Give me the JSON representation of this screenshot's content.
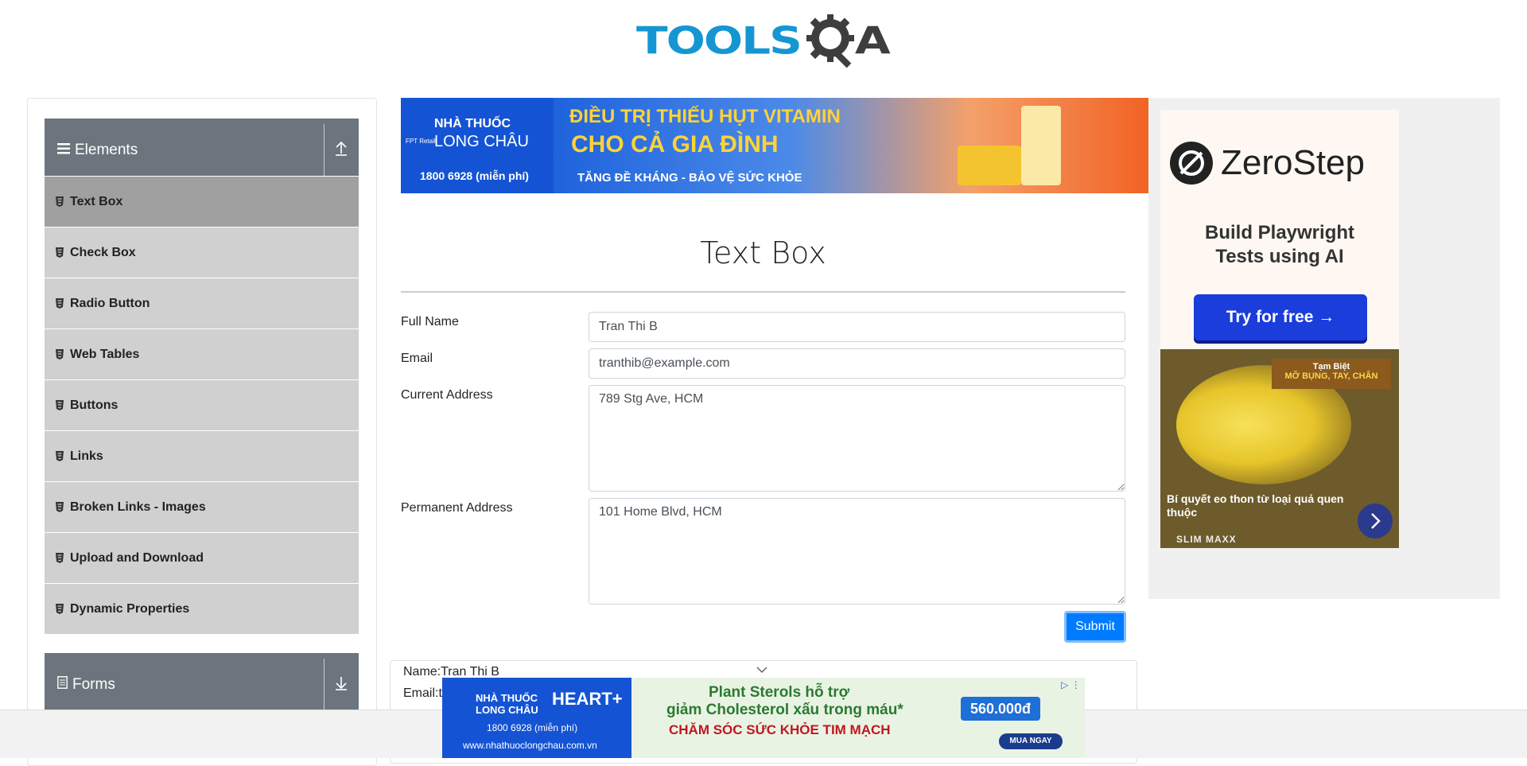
{
  "header": {
    "logo_tools": "TOOLS",
    "logo_a": "A"
  },
  "sidebar": {
    "groups": [
      {
        "title": "Elements",
        "toggle_icon": "collapse-up-icon"
      },
      {
        "title": "Forms",
        "toggle_icon": "expand-down-icon"
      }
    ],
    "items": [
      {
        "label": "Text Box",
        "active": true
      },
      {
        "label": "Check Box"
      },
      {
        "label": "Radio Button"
      },
      {
        "label": "Web Tables"
      },
      {
        "label": "Buttons"
      },
      {
        "label": "Links"
      },
      {
        "label": "Broken Links - Images"
      },
      {
        "label": "Upload and Download"
      },
      {
        "label": "Dynamic Properties"
      }
    ]
  },
  "top_banner": {
    "brand_line1": "NHÀ THUỐC",
    "brand_line2": "LONG CHÂU",
    "fpt": "FPT Retail",
    "phone": "1800 6928 (miễn phí)",
    "line1": "ĐIỀU TRỊ THIẾU HỤT VITAMIN",
    "line2": "CHO CẢ GIA ĐÌNH",
    "line3": "TĂNG ĐỀ KHÁNG - BẢO VỆ SỨC KHỎE"
  },
  "main": {
    "title": "Text Box",
    "form": {
      "full_name_label": "Full Name",
      "full_name_value": "Tran Thi B",
      "email_label": "Email",
      "email_value": "tranthib@example.com",
      "current_address_label": "Current Address",
      "current_address_value": "789 Stg Ave, HCM",
      "permanent_address_label": "Permanent Address",
      "permanent_address_value": "101 Home Blvd, HCM",
      "submit_label": "Submit"
    },
    "output": {
      "name_line": "Name:Tran Thi B",
      "email_line": "Email:tr"
    }
  },
  "side_ad": {
    "zerostep_name": "ZeroStep",
    "zerostep_tagline_1": "Build Playwright",
    "zerostep_tagline_2": "Tests using AI",
    "zerostep_button": "Try for free →",
    "banana_badge_1": "Tạm Biệt",
    "banana_badge_2": "MỠ BỤNG, TAY, CHÂN",
    "banana_text": "Bí quyết eo thon từ loại quả quen thuộc",
    "banana_brand": "SLIM MAXX"
  },
  "bottom_ad": {
    "brand_line1": "NHÀ THUỐC",
    "brand_line2": "LONG CHÂU",
    "heart": "HEART+",
    "phone": "1800 6928 (miễn phí)",
    "web": "www.nhathuoclongchau.com.vn",
    "line1": "Plant Sterols hỗ trợ",
    "line2": "giảm Cholesterol xấu trong máu*",
    "line3": "CHĂM SÓC SỨC KHỎE TIM MẠCH",
    "price": "560.000đ",
    "buy": "MUA NGAY"
  },
  "colors": {
    "accent": "#007bff",
    "sidebar_header": "#6c757d",
    "menu_bg": "#d0d0d0",
    "menu_active": "#a0a0a0",
    "logo_blue": "#1596d2"
  }
}
